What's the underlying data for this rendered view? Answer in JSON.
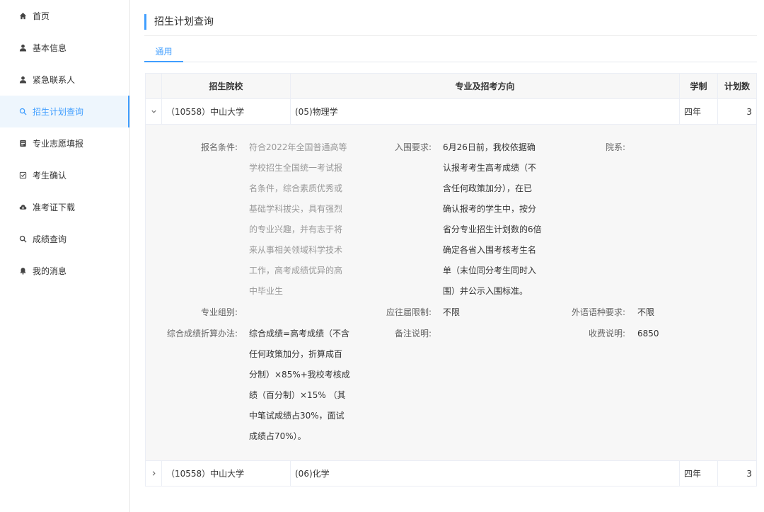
{
  "sidebar": {
    "items": [
      {
        "label": "首页",
        "icon": "home-icon"
      },
      {
        "label": "基本信息",
        "icon": "user-icon"
      },
      {
        "label": "紧急联系人",
        "icon": "user-icon"
      },
      {
        "label": "招生计划查询",
        "icon": "search-icon"
      },
      {
        "label": "专业志愿填报",
        "icon": "form-icon"
      },
      {
        "label": "考生确认",
        "icon": "checkbox-icon"
      },
      {
        "label": "准考证下载",
        "icon": "cloud-download-icon"
      },
      {
        "label": "成绩查询",
        "icon": "search-icon"
      },
      {
        "label": "我的消息",
        "icon": "bell-icon"
      }
    ],
    "active_index": 3
  },
  "page": {
    "title": "招生计划查询",
    "tab_label": "通用"
  },
  "table": {
    "headers": {
      "school": "招生院校",
      "major": "专业及招考方向",
      "duration": "学制",
      "plan_count": "计划数"
    },
    "rows": [
      {
        "school": "（10558）中山大学",
        "major": "(05)物理学",
        "duration": "四年",
        "plan": "3",
        "expanded": true
      },
      {
        "school": "（10558）中山大学",
        "major": "(06)化学",
        "duration": "四年",
        "plan": "3",
        "expanded": false
      }
    ]
  },
  "detail": {
    "labels": {
      "conditions": "报名条件:",
      "entry_requirement": "入围要求:",
      "department": "院系:",
      "major_group": "专业组别:",
      "graduation_limit": "应往届限制:",
      "foreign_lang": "外语语种要求:",
      "score_method": "综合成绩折算办法:",
      "remarks": "备注说明:",
      "fee": "收费说明:"
    },
    "values": {
      "conditions": "符合2022年全国普通高等\n学校招生全国统一考试报\n名条件，综合素质优秀或\n基础学科拔尖，具有强烈\n的专业兴趣，并有志于将\n来从事相关领域科学技术\n工作，高考成绩优异的高\n中毕业生",
      "entry_requirement": "6月26日前，我校依据确\n认报考考生高考成绩（不\n含任何政策加分），在已\n确认报考的学生中，按分\n省分专业招生计划数的6倍\n确定各省入围考核考生名\n单（末位同分考生同时入\n围）并公示入围标准。",
      "department": "",
      "major_group": "",
      "graduation_limit": "不限",
      "foreign_lang": "不限",
      "score_method": "综合成绩=高考成绩（不含\n任何政策加分，折算成百\n分制）×85%+我校考核成\n绩（百分制）×15% （其\n中笔试成绩占30%，面试\n成绩占70%）。",
      "remarks": "",
      "fee": "6850"
    }
  },
  "colors": {
    "accent": "#409eff",
    "active_bg": "#eef6fd",
    "header_bg": "#f7f7f7",
    "detail_bg": "#f7f7f7"
  }
}
